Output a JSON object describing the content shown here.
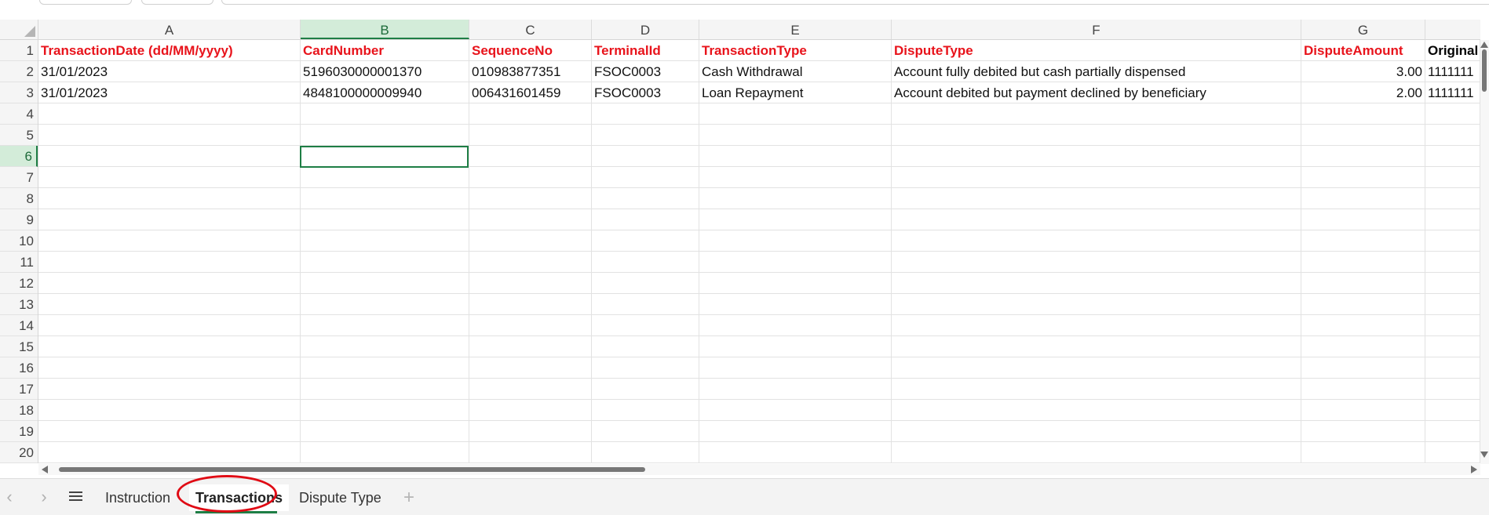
{
  "columns": [
    "A",
    "B",
    "C",
    "D",
    "E",
    "F",
    "G",
    ""
  ],
  "selected_column": "B",
  "rows": [
    "1",
    "2",
    "3",
    "4",
    "5",
    "6",
    "7",
    "8",
    "9",
    "10",
    "11",
    "12",
    "13",
    "14",
    "15",
    "16",
    "17",
    "18",
    "19",
    "20"
  ],
  "selected_row": "6",
  "header_cells": [
    "TransactionDate (dd/MM/yyyy)",
    "CardNumber",
    "SequenceNo",
    "TerminalId",
    "TransactionType",
    "DisputeType",
    "DisputeAmount",
    "Original"
  ],
  "data_rows": [
    [
      "31/01/2023",
      "5196030000001370",
      "010983877351",
      "FSOC0003",
      "Cash Withdrawal",
      "Account fully debited but cash partially dispensed",
      "3.00",
      "1111111"
    ],
    [
      "31/01/2023",
      "4848100000009940",
      "006431601459",
      "FSOC0003",
      "Loan Repayment",
      "Account debited but payment declined by beneficiary",
      "2.00",
      "1111111"
    ]
  ],
  "sheet_tabs": [
    {
      "label": "Instruction",
      "active": false
    },
    {
      "label": "Transactions",
      "active": true
    },
    {
      "label": "Dispute Type",
      "active": false
    }
  ],
  "icons": {
    "prev_sheet": "chevron-left-icon",
    "next_sheet": "chevron-right-icon",
    "all_sheets": "hamburger-menu-icon",
    "add_sheet": "plus-icon"
  },
  "colors": {
    "header_text": "#e8131b",
    "selection": "#1e7e45",
    "highlight_circle": "#e00a14"
  }
}
